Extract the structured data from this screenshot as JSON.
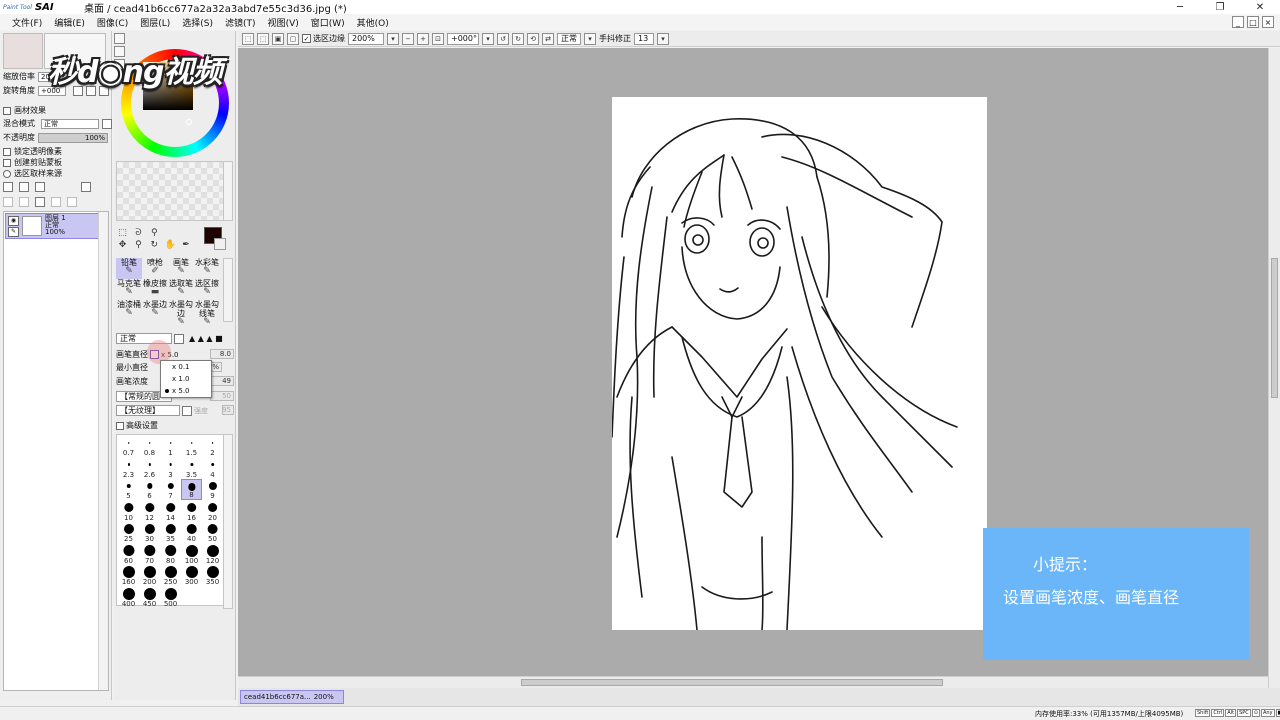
{
  "app": {
    "logo_small": "Paint Tool",
    "logo_big": "SAI",
    "title": "桌面 / cead41b6cc677a2a32a3abd7e55c3d36.jpg (*)",
    "win_minimize": "─",
    "win_restore": "❐",
    "win_close": "✕"
  },
  "menu": {
    "items": [
      "文件(F)",
      "编辑(E)",
      "图像(C)",
      "图层(L)",
      "选择(S)",
      "滤镜(T)",
      "视图(V)",
      "窗口(W)",
      "其他(O)"
    ]
  },
  "toolbar": {
    "selection_edge_label": "选区边缘",
    "zoom_value": "200%",
    "rotation_value": "+000°",
    "blend_value": "正常",
    "stabilizer_label": "手抖修正",
    "stabilizer_value": "13"
  },
  "left_panel": {
    "zoom_label": "缩放倍率",
    "zoom_value": "20",
    "angle_label": "旋转角度",
    "angle_value": "+000",
    "paper_effect_label": "画材效果",
    "blend_mode_label": "混合模式",
    "blend_mode_value": "正常",
    "opacity_label": "不透明度",
    "opacity_value": "100%",
    "lock_alpha_label": "锁定透明像素",
    "clipping_label": "创建剪贴蒙板",
    "selection_source_label": "选区取样来源"
  },
  "layer": {
    "name": "图层 1",
    "mode": "正常",
    "opacity": "100%"
  },
  "brushes": [
    {
      "label": "铅笔",
      "selected": true
    },
    {
      "label": "喷枪",
      "selected": false
    },
    {
      "label": "画笔",
      "selected": false
    },
    {
      "label": "水彩笔",
      "selected": false
    },
    {
      "label": "马克笔",
      "selected": false
    },
    {
      "label": "橡皮擦",
      "selected": false
    },
    {
      "label": "选取笔",
      "selected": false
    },
    {
      "label": "选区擦",
      "selected": false
    },
    {
      "label": "油漆桶",
      "selected": false
    },
    {
      "label": "水墨边",
      "selected": false
    },
    {
      "label": "水墨勾边",
      "selected": false
    },
    {
      "label": "水墨勾线笔",
      "selected": false
    }
  ],
  "brush_settings": {
    "mode_value": "正常",
    "size_label": "画笔直径",
    "size_value": "x 5.0",
    "size_number": "8.0",
    "min_size_label": "最小直径",
    "min_size_value": "%",
    "density_label": "画笔浓度",
    "density_value": "49",
    "shape_value": "【常规的圆",
    "shape_number": "50",
    "texture_value": "【无纹理】",
    "texture_label": "强度",
    "texture_number": "95",
    "advanced_label": "高级设置"
  },
  "size_popup": {
    "options": [
      "x 0.1",
      "x 1.0",
      "x 5.0"
    ],
    "selected_index": 2
  },
  "brush_sizes": [
    "0.7",
    "0.8",
    "1",
    "1.5",
    "2",
    "2.3",
    "2.6",
    "3",
    "3.5",
    "4",
    "5",
    "6",
    "7",
    "8",
    "9",
    "10",
    "12",
    "14",
    "16",
    "20",
    "25",
    "30",
    "35",
    "40",
    "50",
    "60",
    "70",
    "80",
    "100",
    "120",
    "160",
    "200",
    "250",
    "300",
    "350",
    "400",
    "450",
    "500"
  ],
  "selected_size": "8",
  "tip": {
    "title": "小提示：",
    "body": "设置画笔浓度、画笔直径"
  },
  "watermark": "秒d◉ng视频",
  "doc_tab": {
    "name": "cead41b6cc677a...",
    "zoom": "200%"
  },
  "status": {
    "memory": "内存使用率:33% (可用1357MB/上限4095MB)",
    "keys": [
      "Shift",
      "Ctrl",
      "Alt",
      "SPC",
      "⊙",
      "Any",
      "■"
    ]
  }
}
